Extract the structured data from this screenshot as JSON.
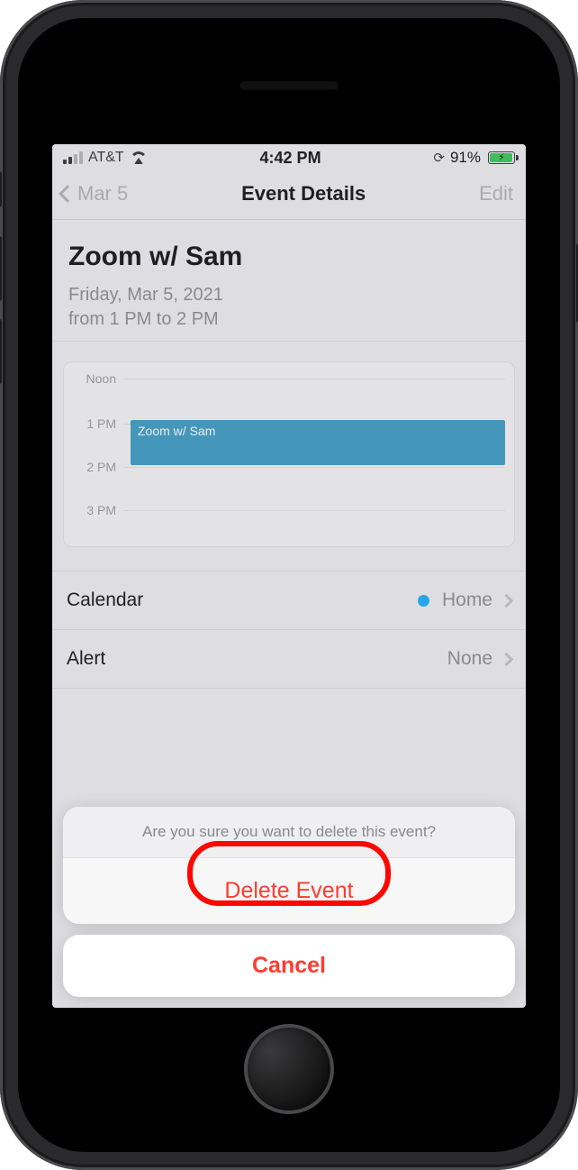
{
  "status": {
    "carrier": "AT&T",
    "time": "4:42 PM",
    "battery_pct": "91%",
    "battery_fill_pct": 91
  },
  "nav": {
    "back": "Mar 5",
    "title": "Event Details",
    "edit": "Edit"
  },
  "event": {
    "title": "Zoom w/ Sam",
    "date": "Friday, Mar 5, 2021",
    "time": "from 1 PM to 2 PM",
    "block_label": "Zoom w/ Sam"
  },
  "timeline_labels": {
    "noon": "Noon",
    "h1": "1 PM",
    "h2": "2 PM",
    "h3": "3 PM"
  },
  "rows": {
    "calendar_label": "Calendar",
    "calendar_value": "Home",
    "alert_label": "Alert",
    "alert_value": "None"
  },
  "sheet": {
    "prompt": "Are you sure you want to delete this event?",
    "delete": "Delete Event",
    "cancel": "Cancel"
  }
}
